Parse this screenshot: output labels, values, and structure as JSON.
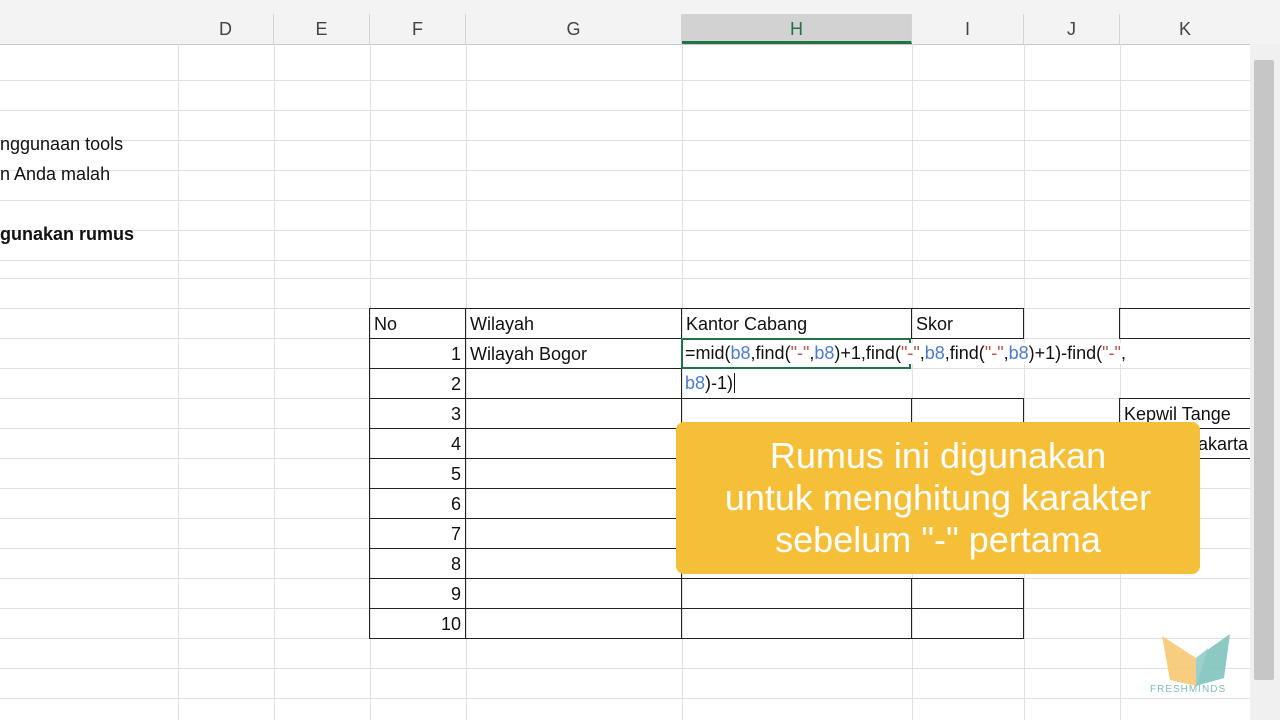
{
  "columns": [
    "D",
    "E",
    "F",
    "G",
    "H",
    "I",
    "J",
    "K"
  ],
  "active_column": "H",
  "left_text": {
    "line1": "nggunaan tools",
    "line2": "n Anda malah",
    "line3_bold": "gunakan rumus"
  },
  "table": {
    "headers": {
      "no": "No",
      "wilayah": "Wilayah",
      "kantor": "Kantor Cabang",
      "skor": "Skor"
    },
    "row_numbers": [
      "1",
      "2",
      "3",
      "4",
      "5",
      "6",
      "7",
      "8",
      "9",
      "10"
    ],
    "row1_wilayah": "Wilayah Bogor"
  },
  "formula": {
    "seg1": "=mid(",
    "seg2": "b8",
    "seg3": ",find(",
    "seg4": "\"-\"",
    "seg5": ",",
    "seg6": "b8",
    "seg7": ")+1,find(",
    "seg8": "\"-\"",
    "seg9": ",",
    "seg10": "b8",
    "seg11": ",find(",
    "seg12": "\"-\"",
    "seg13": ",",
    "seg14": "b8",
    "seg15": ")+1)-find(",
    "seg16": "\"-\"",
    "seg17": ",",
    "line2_ref": "b8",
    "line2_rest": ")-1)"
  },
  "right_cells": {
    "k_r4": "Kepwil Tange",
    "k_r5": "akarta"
  },
  "caption": {
    "line1": "Rumus ini digunakan",
    "line2": "untuk menghitung karakter",
    "line3": "sebelum \"-\" pertama"
  },
  "logo": {
    "text": "FRESHMINDS",
    "colors": [
      "#f6c66a",
      "#7fc3bc"
    ]
  }
}
